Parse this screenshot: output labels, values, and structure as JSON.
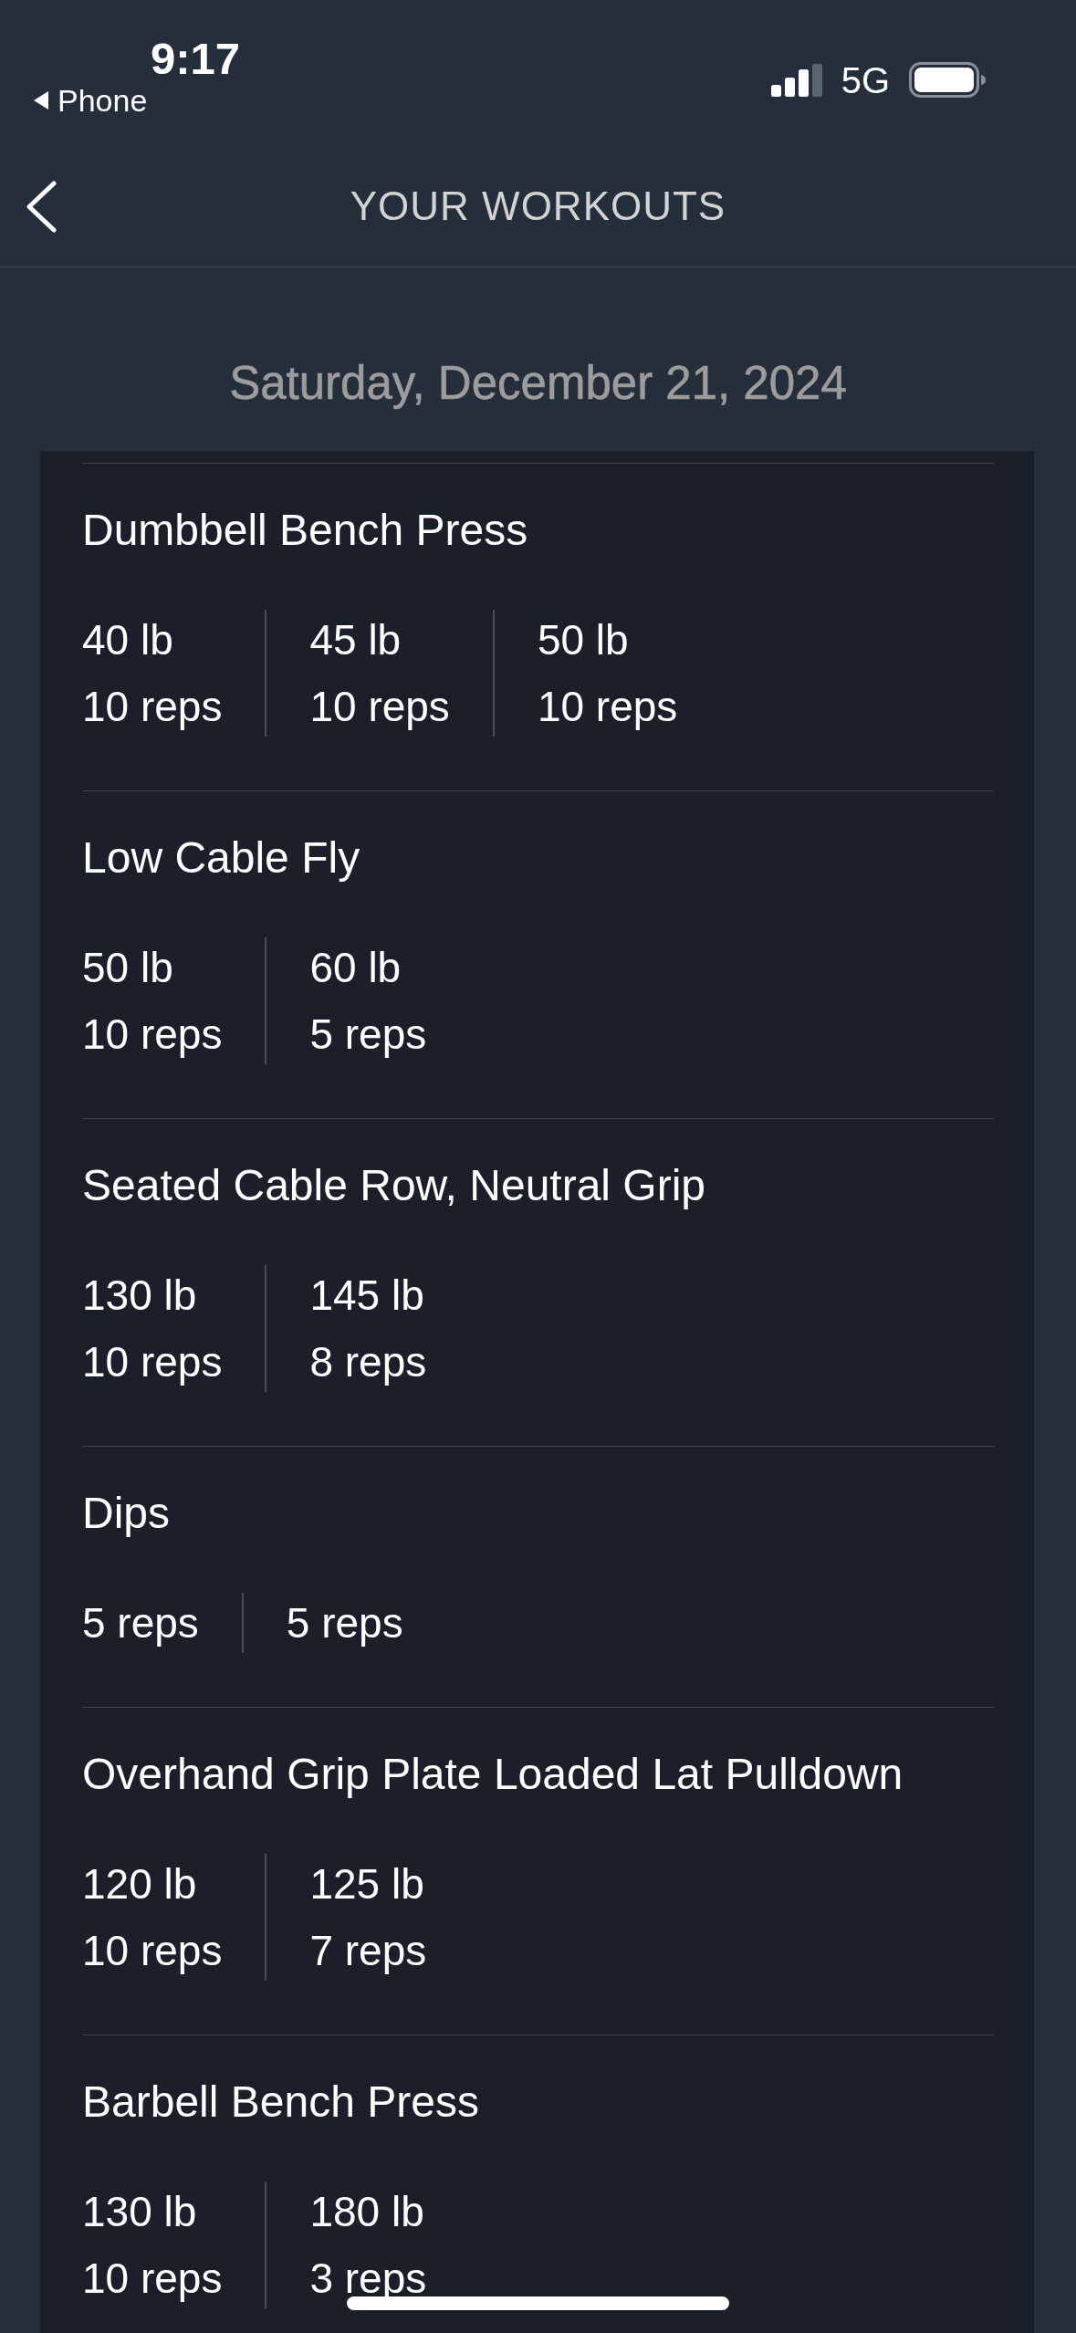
{
  "status_bar": {
    "time": "9:17",
    "back_app": "Phone",
    "network": "5G"
  },
  "header": {
    "title": "YOUR WORKOUTS"
  },
  "date": "Saturday, December 21, 2024",
  "exercises": [
    {
      "name": "Dumbbell Bench Press",
      "sets": [
        {
          "weight": "40 lb",
          "reps": "10 reps"
        },
        {
          "weight": "45 lb",
          "reps": "10 reps"
        },
        {
          "weight": "50 lb",
          "reps": "10 reps"
        }
      ]
    },
    {
      "name": "Low Cable Fly",
      "sets": [
        {
          "weight": "50 lb",
          "reps": "10 reps"
        },
        {
          "weight": "60 lb",
          "reps": "5 reps"
        }
      ]
    },
    {
      "name": "Seated Cable Row, Neutral Grip",
      "sets": [
        {
          "weight": "130 lb",
          "reps": "10 reps"
        },
        {
          "weight": "145 lb",
          "reps": "8 reps"
        }
      ]
    },
    {
      "name": "Dips",
      "sets": [
        {
          "reps": "5 reps"
        },
        {
          "reps": "5 reps"
        }
      ]
    },
    {
      "name": "Overhand Grip Plate Loaded Lat Pulldown",
      "sets": [
        {
          "weight": "120 lb",
          "reps": "10 reps"
        },
        {
          "weight": "125 lb",
          "reps": "7 reps"
        }
      ]
    },
    {
      "name": "Barbell Bench Press",
      "sets": [
        {
          "weight": "130 lb",
          "reps": "10 reps"
        },
        {
          "weight": "180 lb",
          "reps": "3 reps"
        }
      ]
    }
  ]
}
